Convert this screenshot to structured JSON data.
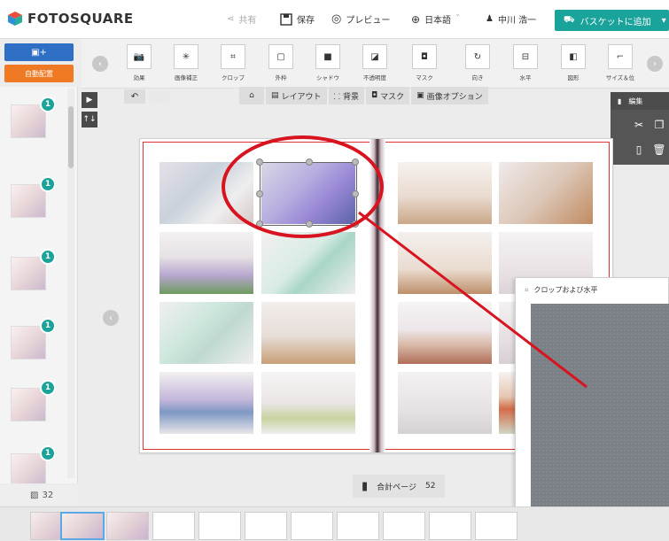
{
  "header": {
    "logo_text": "FOTOSQUARE",
    "share_label": "共有",
    "save_label": "保存",
    "preview_label": "プレビュー",
    "language_label": "日本語",
    "user_name": "中川 浩一",
    "cart_label": "バスケットに追加"
  },
  "left_panel": {
    "add_photos_label": "",
    "auto_layout_label": "自動配置",
    "thumb_badges": [
      "1",
      "1",
      "1",
      "1",
      "1",
      "1"
    ],
    "photo_count": "32"
  },
  "toolbar": {
    "tools": [
      {
        "label": "効果",
        "icon": "camera-effect-icon"
      },
      {
        "label": "画像補正",
        "icon": "sparkle-icon"
      },
      {
        "label": "クロップ",
        "icon": "crop-icon"
      },
      {
        "label": "外枠",
        "icon": "frame-icon"
      },
      {
        "label": "シャドウ",
        "icon": "shadow-icon"
      },
      {
        "label": "不透明度",
        "icon": "opacity-icon"
      },
      {
        "label": "マスク",
        "icon": "mask-icon"
      },
      {
        "label": "向き",
        "icon": "rotate-icon"
      },
      {
        "label": "水平",
        "icon": "horizontal-icon"
      },
      {
        "label": "図形",
        "icon": "shape-icon"
      },
      {
        "label": "サイズ＆位",
        "icon": "size-position-icon"
      }
    ]
  },
  "subbar": {
    "home_icon": "home-icon",
    "layout_label": "レイアウト",
    "background_label": "背景",
    "mask_label": "マスク",
    "image_options_label": "画像オプション"
  },
  "edit_panel": {
    "title": "編集"
  },
  "crop_dialog": {
    "title": "クロップおよび水平"
  },
  "footer": {
    "total_pages_label": "合計ページ",
    "total_pages_value": "52"
  },
  "colors": {
    "accent_teal": "#1aa39a",
    "add_button_blue": "#2f6fc6",
    "auto_button_orange": "#f07a23",
    "annotation_red": "#d7141f"
  }
}
